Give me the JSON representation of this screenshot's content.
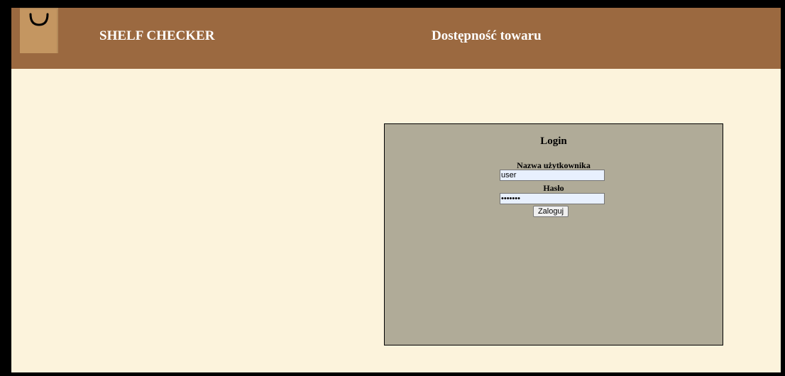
{
  "header": {
    "brand": "SHELF CHECKER",
    "title": "Dostępność towaru",
    "logo_icon": "shopping-bag-icon"
  },
  "login": {
    "title": "Login",
    "username_label": "Nazwa użytkownika",
    "username_value": "user",
    "password_label": "Hasło",
    "password_value": "•••••••",
    "submit_label": "Zaloguj"
  },
  "colors": {
    "header_bg": "#9b6940",
    "page_bg": "#fcf3dc",
    "panel_bg": "#b0ab98",
    "logo_bag": "#c49661"
  }
}
